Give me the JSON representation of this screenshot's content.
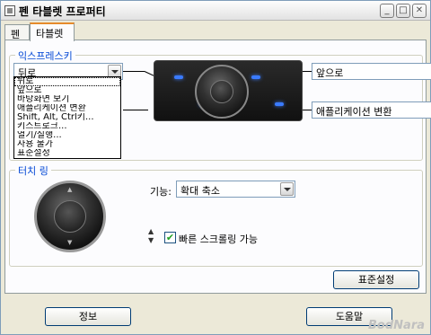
{
  "window": {
    "title": "펜 타블렛 프로퍼티",
    "minimize_label": "_",
    "maximize_label": "□",
    "close_label": "✕"
  },
  "tabs": [
    {
      "label": "펜",
      "active": false
    },
    {
      "label": "타블렛",
      "active": true
    }
  ],
  "express_keys": {
    "group_label": "익스프레스키",
    "left_top_value": "뒤로",
    "right_top_value": "앞으로",
    "right_bottom_value": "애플리케이션 변환",
    "dropdown_options": [
      "뒤로",
      "앞으로",
      "바탕화면 보기",
      "애플리케이션 변환",
      "Shift, Alt, Ctrl키...",
      "키스트로크...",
      "열기/실행...",
      "사용 불가",
      "표준설정"
    ]
  },
  "touch_ring": {
    "group_label": "터치 링",
    "function_label": "기능:",
    "function_value": "확대 축소",
    "fast_scroll_label": "빠른 스크롤링 가능",
    "fast_scroll_checked": true,
    "up_down_glyph_up": "▲",
    "up_down_glyph_down": "▼"
  },
  "buttons": {
    "default_label": "표준설정",
    "info_label": "정보",
    "help_label": "도움말"
  },
  "watermark": "BodNara",
  "colors": {
    "group_label": "#0046d5",
    "tab_active_accent": "#e68b2c",
    "led": "#3a7bff"
  }
}
